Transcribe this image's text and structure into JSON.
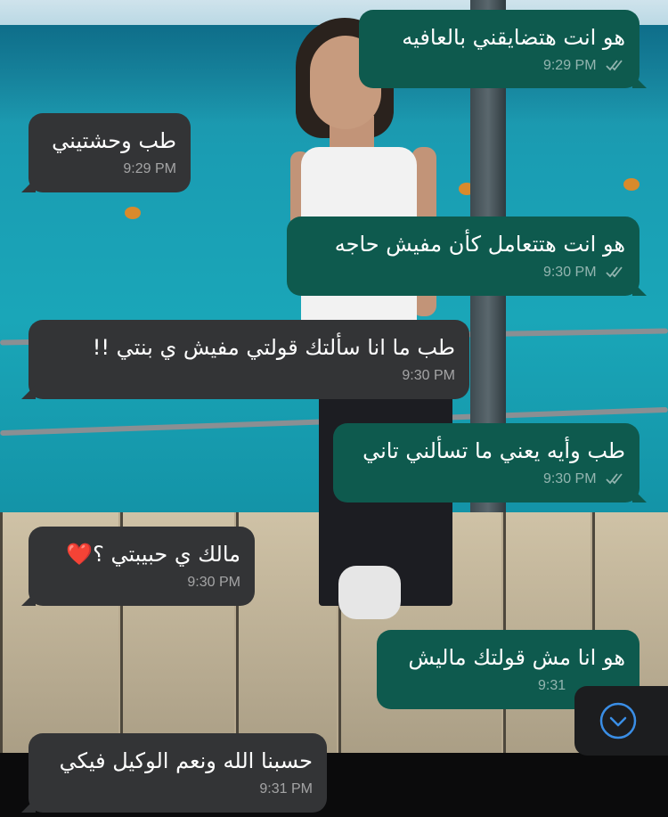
{
  "chat": {
    "messages": [
      {
        "dir": "out",
        "text": "هو انت هتضايقني بالعافيه",
        "time": "9:29 PM"
      },
      {
        "dir": "in",
        "text": "طب وحشتيني",
        "time": "9:29 PM"
      },
      {
        "dir": "out",
        "text": "هو انت هتتعامل كأن مفيش حاجه",
        "time": "9:30 PM"
      },
      {
        "dir": "in",
        "text": "طب ما انا سألتك قولتي مفيش ي بنتي !!",
        "time": "9:30 PM"
      },
      {
        "dir": "out",
        "text": "طب وأيه يعني ما تسألني تاني",
        "time": "9:30 PM"
      },
      {
        "dir": "in",
        "text": "مالك ي حبيبتي ؟❤️",
        "time": "9:30 PM"
      },
      {
        "dir": "out",
        "text": "هو انا مش قولتك ماليش",
        "time": "9:31"
      },
      {
        "dir": "in",
        "text": "حسبنا الله ونعم الوكيل فيكي",
        "time": "9:31 PM"
      }
    ]
  },
  "icons": {
    "read_receipt": "double-check-icon",
    "scroll_down": "chevron-down-circle-icon"
  },
  "colors": {
    "outgoing_bubble": "#0e5a4e",
    "incoming_bubble": "#333436",
    "scroll_icon": "#3a8ee6"
  }
}
